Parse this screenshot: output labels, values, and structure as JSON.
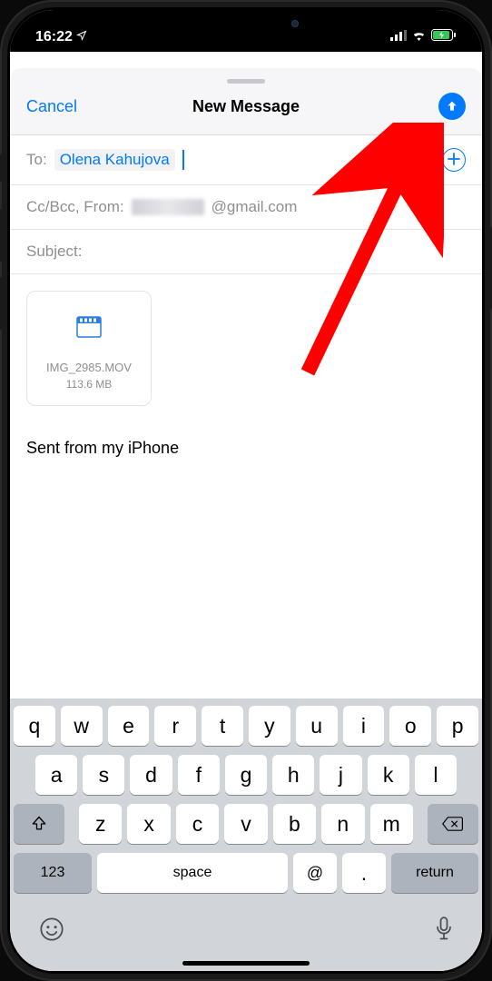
{
  "status": {
    "time": "16:22",
    "signal": "signal",
    "wifi": "wifi",
    "battery": "charging"
  },
  "header": {
    "cancel": "Cancel",
    "title": "New Message",
    "send": "Send"
  },
  "compose": {
    "to_label": "To:",
    "recipient": "Olena Kahujova",
    "ccbcc_from_label": "Cc/Bcc, From:",
    "from_email_suffix": "@gmail.com",
    "subject_label": "Subject:"
  },
  "attachment": {
    "name": "IMG_2985.MOV",
    "size": "113.6 MB"
  },
  "body": {
    "signature": "Sent from my iPhone"
  },
  "keyboard": {
    "row1": [
      "q",
      "w",
      "e",
      "r",
      "t",
      "y",
      "u",
      "i",
      "o",
      "p"
    ],
    "row2": [
      "a",
      "s",
      "d",
      "f",
      "g",
      "h",
      "j",
      "k",
      "l"
    ],
    "row3": [
      "z",
      "x",
      "c",
      "v",
      "b",
      "n",
      "m"
    ],
    "numbers": "123",
    "space": "space",
    "at": "@",
    "dot": ".",
    "return": "return"
  }
}
